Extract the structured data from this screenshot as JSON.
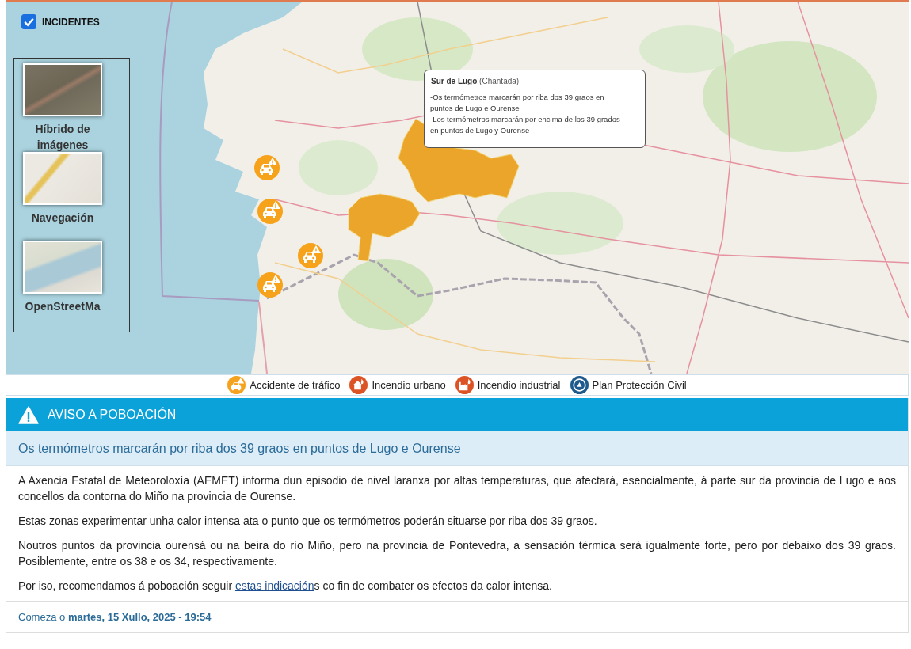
{
  "map": {
    "incidents_toggle": {
      "label": "INCIDENTES",
      "checked": true
    },
    "layers": [
      {
        "label": "Híbrido de imágenes",
        "kind": "satellite"
      },
      {
        "label": "Navegación",
        "kind": "navigation"
      },
      {
        "label": "OpenStreetMa",
        "kind": "osm"
      }
    ],
    "markers": [
      {
        "kind": "traffic_accident"
      },
      {
        "kind": "traffic_accident"
      },
      {
        "kind": "traffic_accident"
      },
      {
        "kind": "traffic_accident"
      }
    ],
    "popup": {
      "title": "**Sur de Lugo** (Chantada)",
      "lines": [
        "-Os termómetros marcarán por riba dos 39 graos en puntos de Lugo e Ourense",
        "-Los termómetros marcarán por encima de los 39 grados en puntos de Lugo y Ourense"
      ]
    }
  },
  "legend": [
    {
      "kind": "traffic_accident",
      "label": "Accidente de tráfico"
    },
    {
      "kind": "urban_fire",
      "label": "Incendio urbano"
    },
    {
      "kind": "industrial_fire",
      "label": "Incendio industrial"
    },
    {
      "kind": "civil_protection",
      "label": "Plan Protección Civil"
    }
  ],
  "alert": {
    "heading": "AVISO A POBOACIÓN",
    "title": "Os termómetros marcarán por riba dos 39 graos en puntos de Lugo e Ourense",
    "paragraphs": [
      {
        "text": "A Axencia Estatal de Meteoroloxía (AEMET) informa dun episodio de nivel laranxa por altas temperaturas, que afectará, esencialmente, á parte sur da provincia de Lugo e aos concellos da contorna do Miño na provincia de Ourense."
      },
      {
        "text": "Estas zonas experimentar unha calor intensa ata o punto que os termómetros poderán situarse por riba dos 39 graos."
      },
      {
        "text": "Noutros puntos da provincia ourensá ou na beira do río Miño, pero na provincia de Pontevedra, a sensación térmica será igualmente forte, pero por debaixo dos 39 graos. Posiblemente, entre os 38 e os 34, respectivamente."
      },
      {
        "text": "Por iso, recomendamos á poboación seguir ",
        "link": "estas indicación",
        "after": "s co fin de combater os efectos da calor intensa."
      }
    ],
    "starts": "Comeza o **martes, 15 Xullo, 2025 - 19:54**"
  }
}
